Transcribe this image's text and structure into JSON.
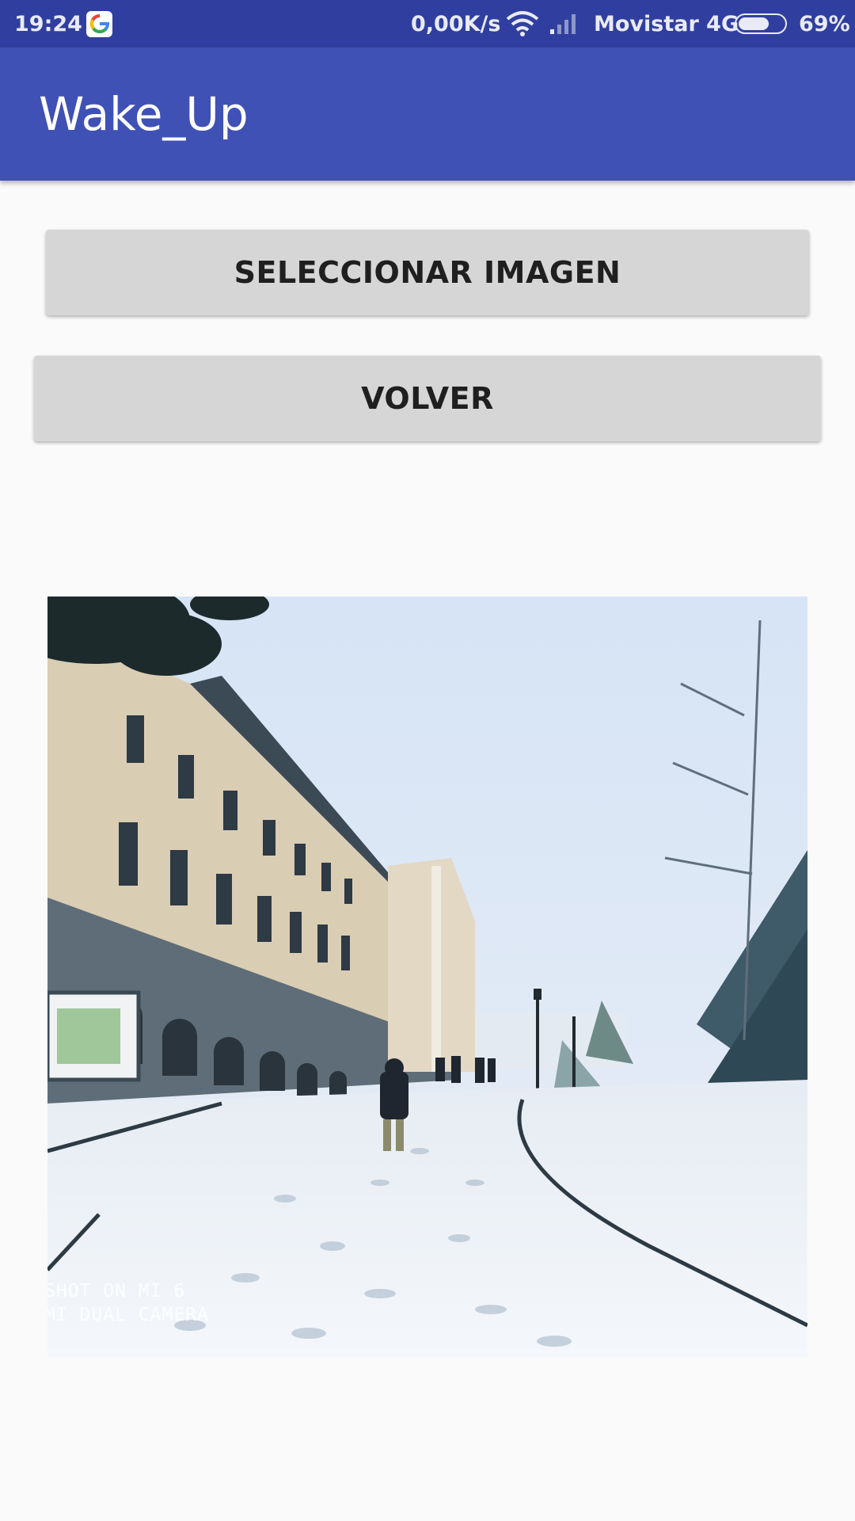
{
  "status_bar": {
    "time": "19:24",
    "speed": "0,00K/s",
    "carrier": "Movistar 4G",
    "battery_percent": "69%",
    "battery_level": 0.69,
    "notification_icon": "google-g-icon"
  },
  "app_bar": {
    "title": "Wake_Up",
    "color": "#3f51b5"
  },
  "buttons": {
    "select_image": "SELECCIONAR IMAGEN",
    "back": "VOLVER"
  },
  "image": {
    "watermark_line1": "SHOT ON MI 6",
    "watermark_line2": "MI DUAL CAMERA"
  },
  "colors": {
    "status_bar": "#303f9f",
    "app_bar": "#3f51b5",
    "button": "#d6d6d6",
    "background": "#fafafa"
  }
}
